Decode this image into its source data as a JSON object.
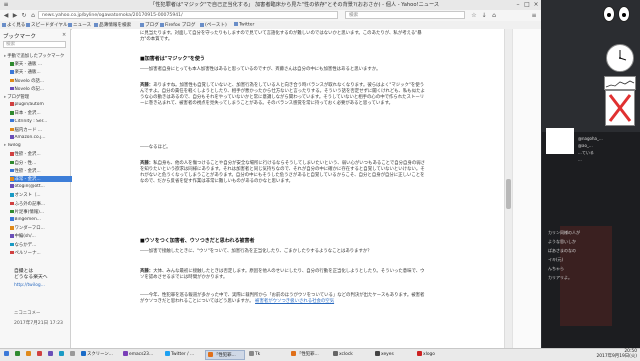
{
  "browser": {
    "window_title": "「性犯罪者は\"マジック\"で自己正当化する」 加害者臨床から見た\"性の依存\"とその背景?(おおさか) - 個人 - Yahoo!ニュース",
    "url": "news.yahoo.co.jp/byline/ogawatomoka/20170915-00075941/",
    "search_placeholder": "検索",
    "bookmarks": [
      "よく見る",
      "スピードダイヤル",
      "ニュース",
      "品薄情報を検索",
      "ブログ",
      "Firefox ブログ",
      "(ペースト)",
      "Twitter"
    ]
  },
  "sidebar": {
    "title": "ブックマーク",
    "close": "×",
    "search_placeholder": "検索",
    "items": [
      {
        "label": "手動で追加したブックマーク",
        "type": "folder"
      },
      {
        "label": "楽天 - 通販 ...",
        "type": "item"
      },
      {
        "label": "楽天 - 通販...",
        "type": "item"
      },
      {
        "label": "Novelo の話...",
        "type": "item"
      },
      {
        "label": "Novelo の記...",
        "type": "item"
      },
      {
        "label": "ブログ管理",
        "type": "folder"
      },
      {
        "label": "plugin/autom",
        "type": "item"
      },
      {
        "label": "日本 - 金沢...",
        "type": "item"
      },
      {
        "label": "Citrinity : Ser...",
        "type": "item"
      },
      {
        "label": "脳内カード ...",
        "type": "item"
      },
      {
        "label": "Amazon.co.j...",
        "type": "item"
      },
      {
        "label": "Twilog",
        "type": "folder"
      },
      {
        "label": "性欲 - 金沢...",
        "type": "item"
      },
      {
        "label": "自分 - 性...",
        "type": "item"
      },
      {
        "label": "性欲 - 金沢...",
        "type": "item"
      },
      {
        "label": "非常 - 金沢...",
        "type": "selected"
      },
      {
        "label": "otogin(@ott...",
        "type": "item"
      },
      {
        "label": "オンスト（...",
        "type": "item"
      },
      {
        "label": "ふろ外の記事...",
        "type": "item"
      },
      {
        "label": "片足事(情報)...",
        "type": "item"
      },
      {
        "label": "Bingemen...",
        "type": "item"
      },
      {
        "label": "ワンダーフロ...",
        "type": "item"
      },
      {
        "label": "中編(sh/...",
        "type": "item"
      },
      {
        "label": "ならかデ...",
        "type": "item"
      },
      {
        "label": "ペルソーナ...",
        "type": "item"
      }
    ],
    "twit_text_1": "自撮とは",
    "twit_text_2": "どうなる楽天へ",
    "twit_link": "http://twilog...",
    "nicocom": "ニコニコメー",
    "date": "2017年7月21日 17:23"
  },
  "article": {
    "p0": "に見当たります。対面して自分を守ったりもしますので見ていて言語化するのが難しいのではないかと思います。このあたりが、私が考える\"暴力\"の本質です。",
    "h1": "■加害者は\"マジック\"を使う",
    "p1": "――加害者自身にとっても本人加害性はあると思っているのですが、斉藤さんは自分の中にも加害性はあると思いますか。",
    "p2_spk": "斉藤：",
    "p2": "ありますね。加害性も自覚していないと、加害行為をしている人と向き合う時バランスが取れなくなります。彼らはよく\"マジック\"を使うんですよ。自分の責任を軽くしようとしたり、相手が悪かったから仕方ないと言ったりする。そういう話を否定せずに聞くけれども、私も似たような心の動きはあるので、自分もそれをやっていないかと常に意識しながら関わっています。そうしていないと相手の心の中で作られたストーリーに巻き込まれて、被害者の視点を見失ってしまうことがある。そのバランス感覚を常に持っておく必要があると思っています。",
    "p3": "――なるほど。",
    "p4_spk": "斉藤：",
    "p4": "私自身も、他の人を傷つけることや自分が安全な場所に行けるならそうしてしまいたいという、弱い心がいつもあることで自分自身の弱さを知りたいという欲求は同様にあります。それは加害者と同じ気持ちなので、それが自分の中に確かに存在すると自覚していないといけない。それがないと危うくなってしまうことがあります。自分の中にもそうした危うさがあると自覚しているからこそ、自分と自身が自分に正しいことをなので、だから反省を促す作業は非常に難しいものがあるのかなと思います。",
    "h2": "■ウソをつく加害者、ウソつきだと思われる被害者",
    "p5": "――加害で接触したときに、\"ウソ\"をついて、加害行為を正当化したり、ごまかしたりするようなことはありますか？",
    "p6_spk": "斉藤：",
    "p6": "大体、みんな最初に接触したときは否定します。原因を他人のせいにしたり、自分の行動を正当化しようとしたり。そういった意味で、ウソを認めさせるまでには時間がかかります。",
    "p7": "――今年、性犯罪を巡る報道が多かった中で、実際に裁判所から「お前のほうがウソをついている」などの判決が出たケースもあります。被害者がウソつきだと思われることについてはどう思いますか。",
    "link_text": "被害者がウソつき扱いされる社会の空気"
  },
  "desktop": {
    "chat_lines": [
      "@nagoha_...",
      "@ao_...",
      "...ている",
      "...",
      "カリン同様の人が",
      "ような思いしか",
      "ばあさまのなの",
      "イキ(元)",
      "んちゃら",
      "カリアリよ。"
    ]
  },
  "taskbar": {
    "items": [
      {
        "label": "",
        "type": "icon",
        "color": "#3b78d8"
      },
      {
        "label": "",
        "type": "icon",
        "color": "#2f8a2f"
      },
      {
        "label": "",
        "type": "icon",
        "color": "#e08a1a"
      },
      {
        "label": "",
        "type": "icon",
        "color": "#d04040"
      },
      {
        "label": "",
        "type": "icon",
        "color": "#6a4fb8"
      },
      {
        "label": "",
        "type": "icon",
        "color": "#1a9ac4"
      },
      {
        "label": "",
        "type": "icon",
        "color": "#999999"
      },
      {
        "label": "スクリーン...",
        "type": "window",
        "color": "#1a6cc8"
      },
      {
        "label": "emacs23...",
        "type": "window",
        "color": "#7a3fb8"
      },
      {
        "label": "Twitter / ...",
        "type": "window",
        "color": "#1da1f2"
      },
      {
        "label": "「性犯罪...",
        "type": "window-active",
        "color": "#e0701a"
      },
      {
        "label": "Tk",
        "type": "window",
        "color": "#888888"
      },
      {
        "label": "「性犯罪...",
        "type": "window",
        "color": "#e0701a"
      },
      {
        "label": "xclock",
        "type": "window",
        "color": "#666666"
      },
      {
        "label": "xeyes",
        "type": "window",
        "color": "#444444"
      },
      {
        "label": "xlogo",
        "type": "window",
        "color": "#cc2222"
      }
    ],
    "clock_time": "20:50",
    "clock_date": "2017年9月19日(火)"
  },
  "colors": {
    "accent": "#3d7ed8",
    "selected_bg": "#3d7ed8",
    "xlogo": "#e03030"
  }
}
